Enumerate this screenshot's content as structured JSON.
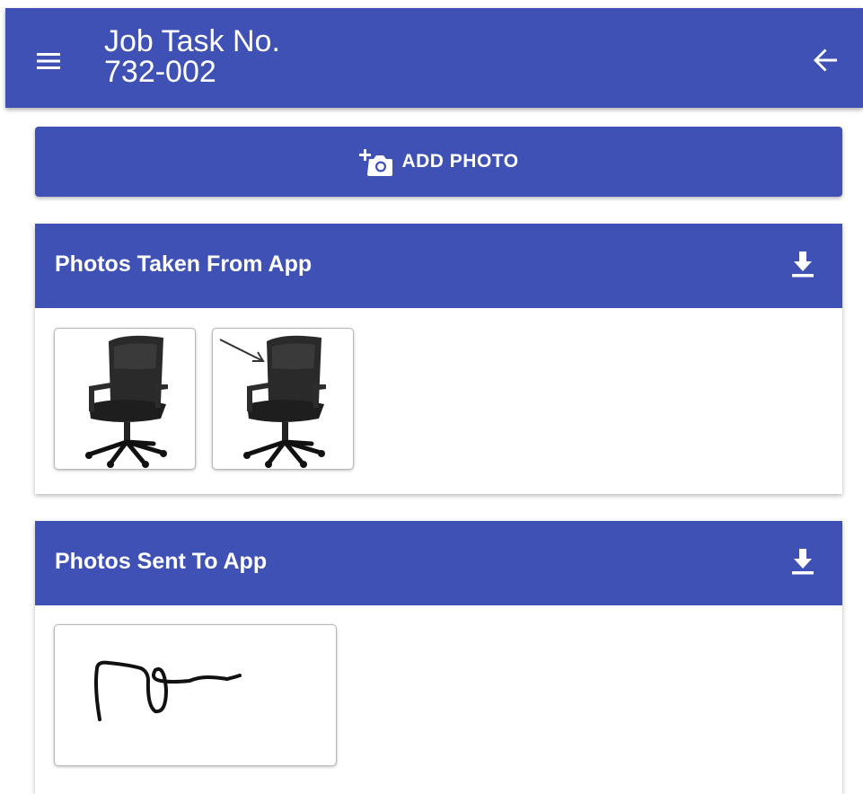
{
  "header": {
    "title_line1": "Job Task No.",
    "title_line2": "732-002",
    "menu_icon": "menu-icon",
    "back_icon": "arrow-back-icon"
  },
  "add_photo": {
    "label": "ADD PHOTO",
    "icon": "add-a-photo-icon"
  },
  "sections": [
    {
      "title": "Photos Taken From App",
      "action_icon": "download-icon",
      "photos": [
        {
          "subject": "office-chair"
        },
        {
          "subject": "office-chair-with-arrow-annotation"
        }
      ]
    },
    {
      "title": "Photos Sent To App",
      "action_icon": "download-icon",
      "photos": [
        {
          "subject": "handwritten-signature"
        }
      ]
    }
  ],
  "colors": {
    "primary": "#3f51b5",
    "on_primary": "#ffffff",
    "surface": "#ffffff"
  }
}
